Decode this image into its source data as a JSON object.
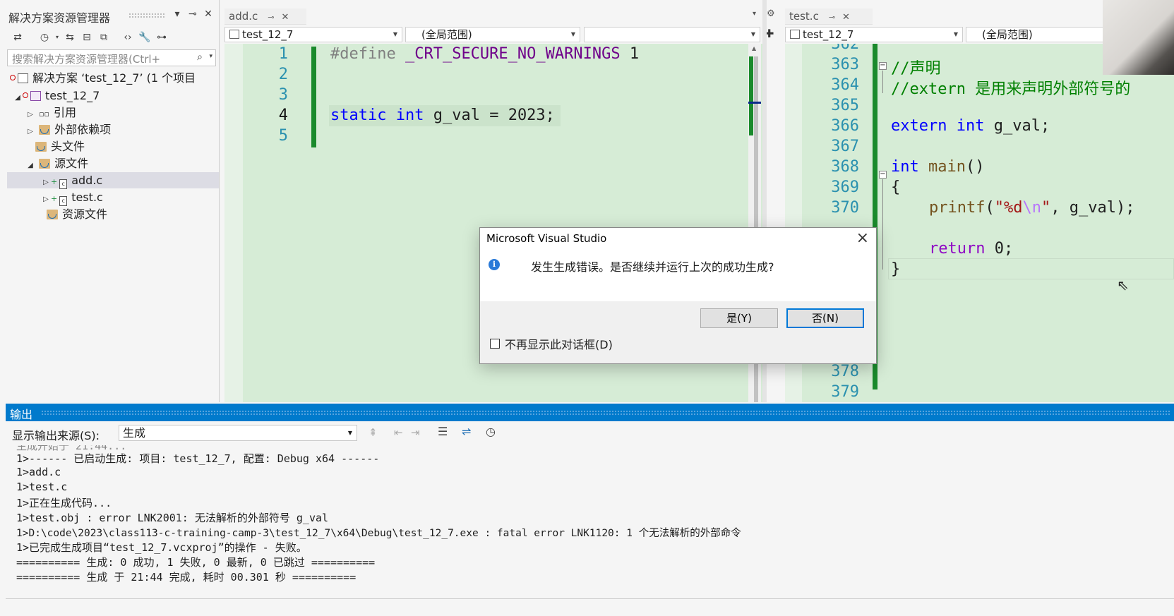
{
  "solution_explorer": {
    "title": "解决方案资源管理器",
    "search_placeholder": "搜索解决方案资源管理器(Ctrl+",
    "tree": [
      {
        "label": "解决方案 ‘test_12_7’ (1 个项目",
        "kind": "solution"
      },
      {
        "label": "test_12_7",
        "kind": "project"
      },
      {
        "label": "引用",
        "kind": "references"
      },
      {
        "label": "外部依赖项",
        "kind": "external-deps"
      },
      {
        "label": "头文件",
        "kind": "folder"
      },
      {
        "label": "源文件",
        "kind": "folder"
      },
      {
        "label": "add.c",
        "kind": "c-file",
        "selected": true
      },
      {
        "label": "test.c",
        "kind": "c-file"
      },
      {
        "label": "资源文件",
        "kind": "folder"
      }
    ]
  },
  "editor_left": {
    "tab": "add.c",
    "nav_project": "test_12_7",
    "nav_scope": "(全局范围)",
    "nav_member": "",
    "line_numbers": [
      "1",
      "2",
      "3",
      "4",
      "5"
    ],
    "code": {
      "l1_define": "#define",
      "l1_macro": "_CRT_SECURE_NO_WARNINGS",
      "l1_value": "1",
      "l4_static": "static",
      "l4_int": "int",
      "l4_rest": "g_val = 2023;"
    }
  },
  "editor_right": {
    "tab": "test.c",
    "nav_project": "test_12_7",
    "nav_scope": "(全局范围)",
    "line_numbers": [
      "362",
      "363",
      "364",
      "365",
      "366",
      "367",
      "368",
      "369",
      "370",
      "378",
      "379"
    ],
    "code": {
      "c1": "//声明",
      "c2": "//extern 是用来声明外部符号的",
      "extern_kw": "extern",
      "extern_int": "int",
      "extern_rest": "g_val;",
      "main_int": "int",
      "main_name": "main",
      "main_parens": "()",
      "brace_open": "{",
      "printf": "printf",
      "printf_open": "(",
      "str_q1": "\"",
      "str_fmt": "%d",
      "str_esc": "\\n",
      "str_q2": "\"",
      "printf_rest": ", g_val);",
      "return_kw": "return",
      "return_rest": "0;",
      "brace_close": "}"
    }
  },
  "dialog": {
    "title": "Microsoft Visual Studio",
    "message": "发生生成错误。是否继续并运行上次的成功生成?",
    "yes": "是(Y)",
    "no": "否(N)",
    "checkbox": "不再显示此对话框(D)"
  },
  "output": {
    "title": "输出",
    "source_label": "显示输出来源(S):",
    "source_value": "生成",
    "lines": [
      "1>------ 已启动生成: 项目: test_12_7, 配置: Debug x64 ------",
      "1>add.c",
      "1>test.c",
      "1>正在生成代码...",
      "1>test.obj : error LNK2001: 无法解析的外部符号 g_val",
      "1>D:\\code\\2023\\class113-c-training-camp-3\\test_12_7\\x64\\Debug\\test_12_7.exe : fatal error LNK1120: 1 个无法解析的外部命令",
      "1>已完成生成项目“test_12_7.vcxproj”的操作 - 失败。",
      "========== 生成: 0 成功, 1 失败, 0 最新, 0 已跳过 ==========",
      "========== 生成 于 21:44 完成, 耗时 00.301 秒 =========="
    ]
  },
  "colors": {
    "editor_bg": "#d6ecd6",
    "change_bar": "#1a8a2c",
    "accent": "#007acc"
  }
}
